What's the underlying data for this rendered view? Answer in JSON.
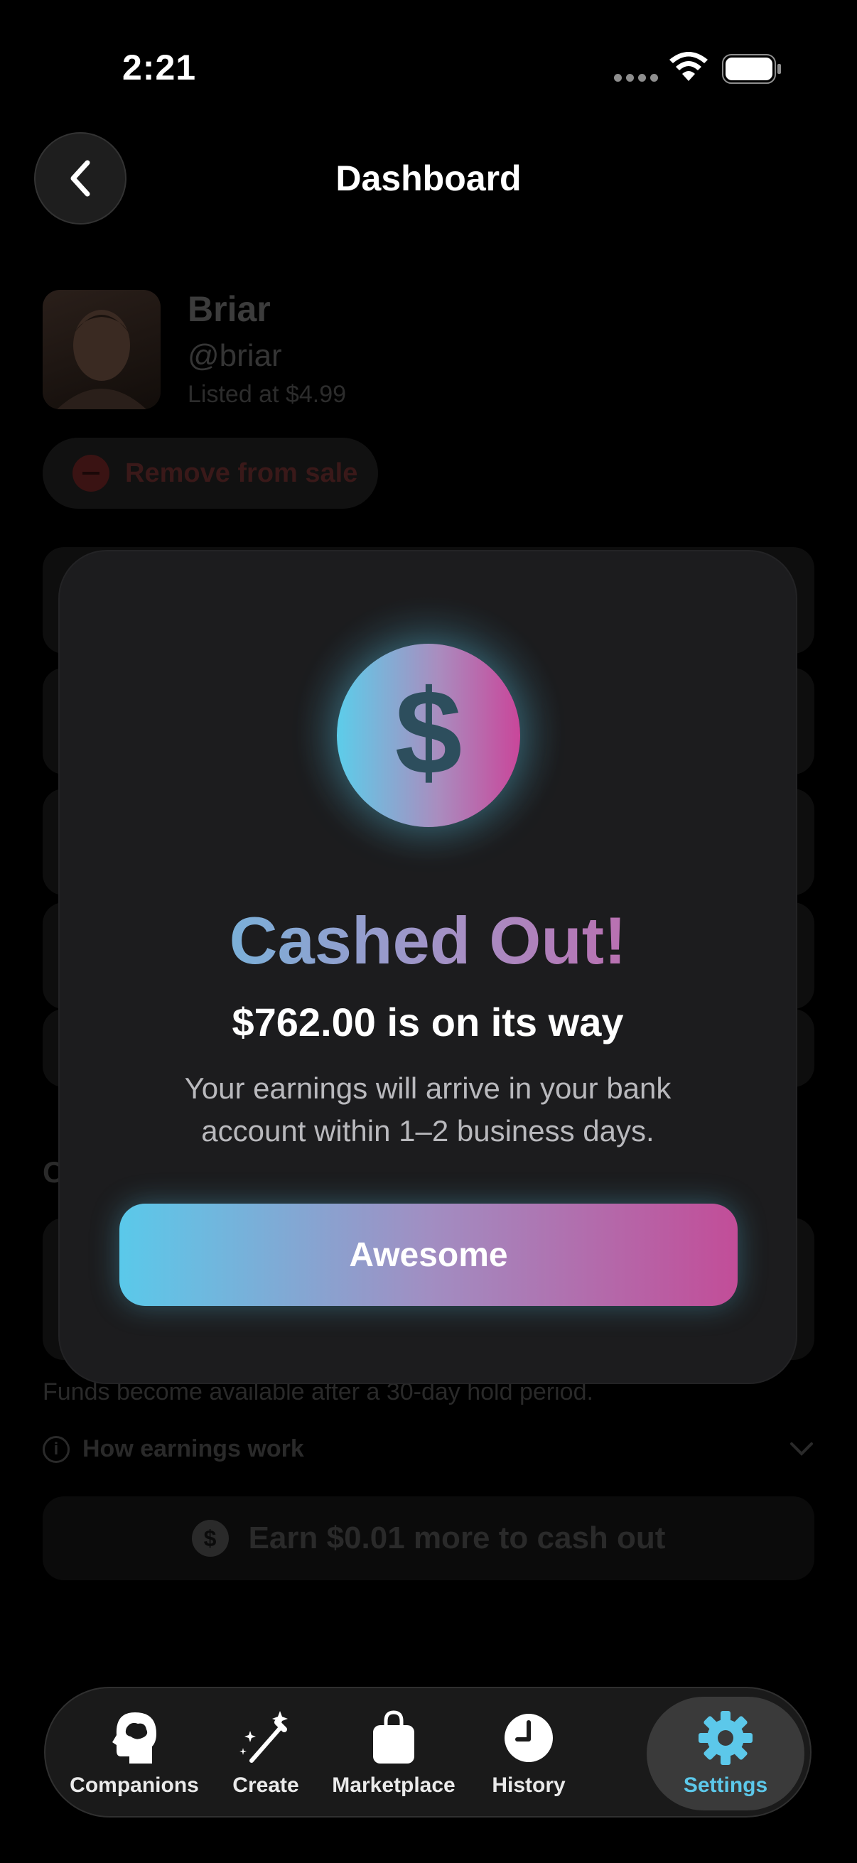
{
  "status_bar": {
    "time": "2:21"
  },
  "header": {
    "title": "Dashboard"
  },
  "profile": {
    "name": "Briar",
    "handle": "@briar",
    "price": "Listed at $4.99",
    "remove_label": "Remove from sale"
  },
  "underlay": {
    "section_letter": "C",
    "funds_note": "Funds become available after a 30-day hold period.",
    "how_earnings": "How earnings work",
    "earn_more": "Earn $0.01 more to cash out"
  },
  "modal": {
    "icon_glyph": "$",
    "title": "Cashed Out!",
    "subtitle": "$762.00 is on its way",
    "body": "Your earnings will arrive in your bank account within 1–2 business days.",
    "button_label": "Awesome"
  },
  "tabs": [
    {
      "label": "Companions",
      "icon": "head-icon"
    },
    {
      "label": "Create",
      "icon": "magic-wand-icon"
    },
    {
      "label": "Marketplace",
      "icon": "shopping-bag-icon"
    },
    {
      "label": "History",
      "icon": "clock-icon"
    },
    {
      "label": "Settings",
      "icon": "gear-icon",
      "active": true
    }
  ],
  "colors": {
    "accent_cyan": "#5cc8ea",
    "accent_pink": "#c9469a",
    "background": "#000000",
    "modal": "#1c1c1e"
  }
}
